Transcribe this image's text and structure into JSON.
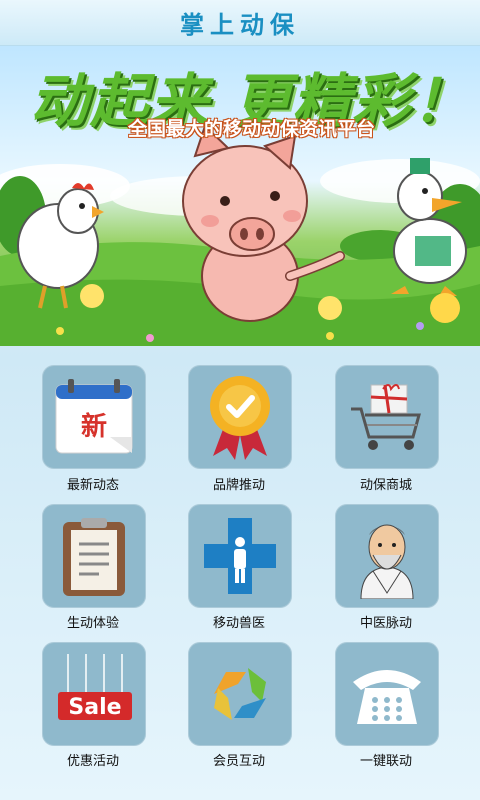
{
  "app": {
    "title": "掌上动保"
  },
  "banner": {
    "headline": "动起来 更精彩！",
    "tagline": "全国最大的移动动保资讯平台"
  },
  "menu": [
    {
      "label": "最新动态",
      "icon": "calendar-icon",
      "icon_text": "新"
    },
    {
      "label": "品牌推动",
      "icon": "award-badge-icon"
    },
    {
      "label": "动保商城",
      "icon": "shopping-cart-icon"
    },
    {
      "label": "生动体验",
      "icon": "clipboard-icon"
    },
    {
      "label": "移动兽医",
      "icon": "medical-cross-icon"
    },
    {
      "label": "中医脉动",
      "icon": "doctor-portrait-icon"
    },
    {
      "label": "优惠活动",
      "icon": "sale-sign-icon",
      "icon_text": "Sale"
    },
    {
      "label": "会员互动",
      "icon": "recycle-arrows-icon"
    },
    {
      "label": "一键联动",
      "icon": "telephone-icon"
    }
  ]
}
